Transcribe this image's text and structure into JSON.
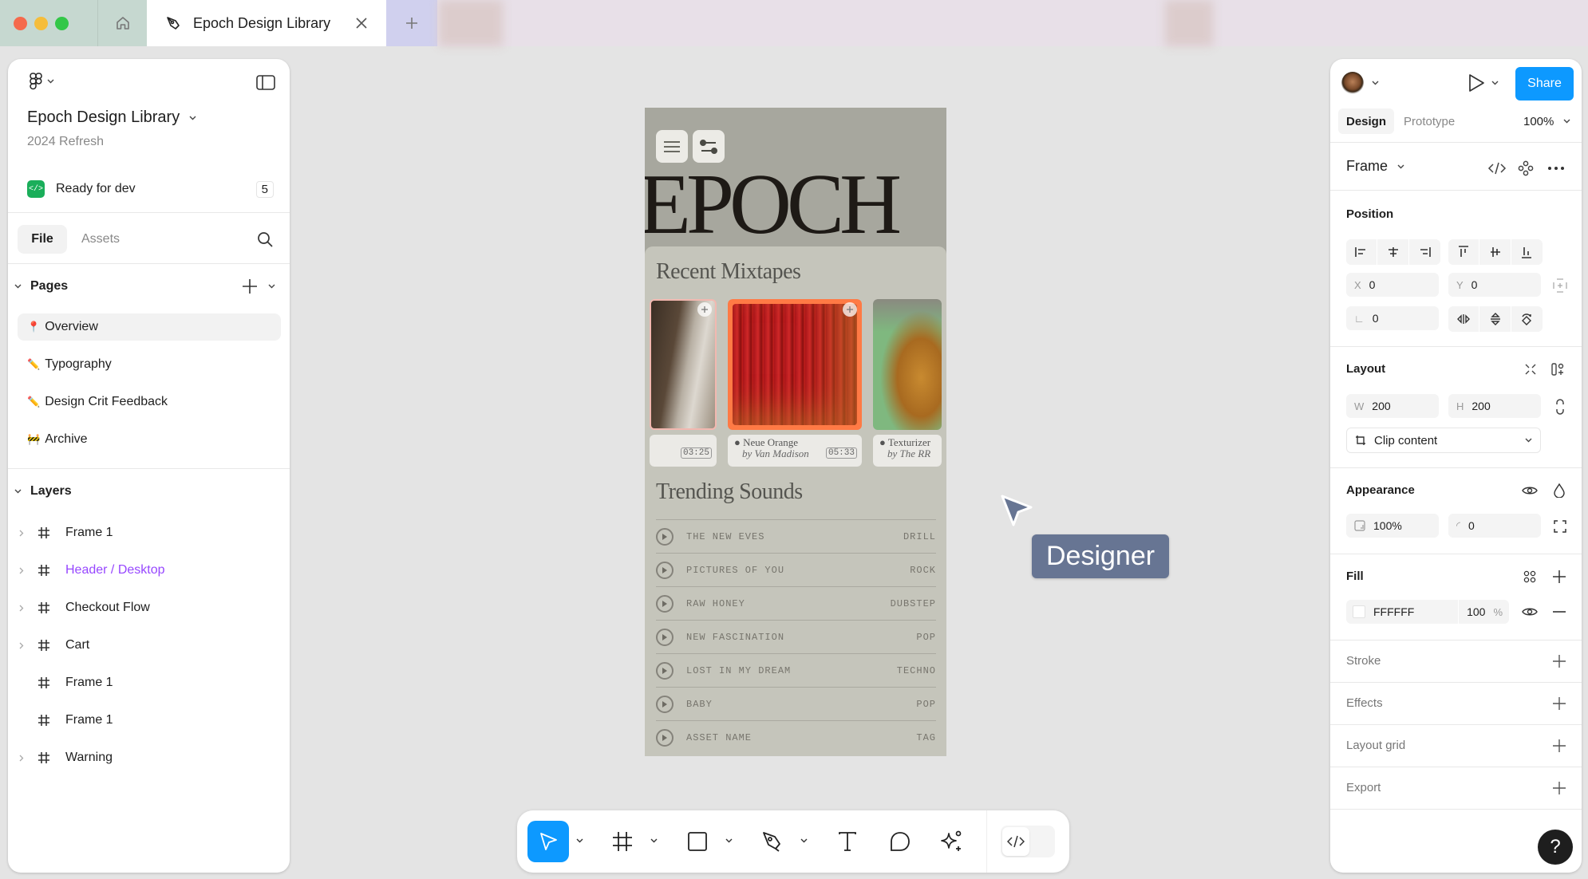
{
  "window": {
    "tab_title": "Epoch Design Library",
    "traffic_colors": [
      "#f56a4c",
      "#f5bd3a",
      "#33c748"
    ]
  },
  "left_panel": {
    "project_title": "Epoch Design Library",
    "project_subtitle": "2024 Refresh",
    "status_label": "Ready for dev",
    "status_count": "5",
    "tabs": [
      {
        "label": "File",
        "active": true
      },
      {
        "label": "Assets",
        "active": false
      }
    ],
    "pages_header": "Pages",
    "pages": [
      {
        "emoji": "📍",
        "label": "Overview",
        "selected": true
      },
      {
        "emoji": "✏️",
        "label": "Typography",
        "selected": false
      },
      {
        "emoji": "✏️",
        "label": "Design Crit Feedback",
        "selected": false
      },
      {
        "emoji": "🚧",
        "label": "Archive",
        "selected": false
      }
    ],
    "layers_header": "Layers",
    "layers": [
      {
        "label": "Frame 1",
        "expandable": true,
        "highlight": false
      },
      {
        "label": "Header / Desktop",
        "expandable": true,
        "highlight": true
      },
      {
        "label": "Checkout Flow",
        "expandable": true,
        "highlight": false
      },
      {
        "label": "Cart",
        "expandable": true,
        "highlight": false
      },
      {
        "label": "Frame 1",
        "expandable": false,
        "highlight": false
      },
      {
        "label": "Frame 1",
        "expandable": false,
        "highlight": false
      },
      {
        "label": "Warning",
        "expandable": true,
        "highlight": false
      }
    ],
    "highlight_color": "#9747ff"
  },
  "canvas": {
    "frame": {
      "brand": "EPOCH",
      "recent_heading": "Recent Mixtapes",
      "mixtapes": [
        {
          "title": "",
          "artist": "",
          "duration": "03:25",
          "accent": "#f2b8b0"
        },
        {
          "title": "Neue Orange",
          "artist": "by Van Madison",
          "duration": "05:33",
          "accent": "#ff7a45"
        },
        {
          "title": "Texturizer",
          "artist": "by The RR",
          "duration": "",
          "accent": "#7fb87f"
        }
      ],
      "trending_heading": "Trending Sounds",
      "tracks": [
        {
          "name": "THE NEW EVES",
          "tag": "DRILL"
        },
        {
          "name": "PICTURES OF YOU",
          "tag": "ROCK"
        },
        {
          "name": "RAW HONEY",
          "tag": "DUBSTEP"
        },
        {
          "name": "NEW FASCINATION",
          "tag": "POP"
        },
        {
          "name": "LOST IN MY DREAM",
          "tag": "TECHNO"
        },
        {
          "name": "BABY",
          "tag": "POP"
        },
        {
          "name": "ASSET NAME",
          "tag": "TAG"
        }
      ]
    },
    "cursor_label": "Designer",
    "cursor_color": "#677593"
  },
  "toolbar": {
    "tools": [
      "move",
      "frame",
      "rectangle",
      "pen",
      "text",
      "comment",
      "actions"
    ],
    "active_tool": "move",
    "accent": "#0d99ff",
    "dev_mode_icon": "code-icon"
  },
  "right_panel": {
    "share_label": "Share",
    "tabs": [
      {
        "label": "Design",
        "active": true
      },
      {
        "label": "Prototype",
        "active": false
      }
    ],
    "zoom": "100%",
    "selection_type": "Frame",
    "position": {
      "title": "Position",
      "x_label": "X",
      "x": "0",
      "y_label": "Y",
      "y": "0",
      "rotation": "0"
    },
    "layout": {
      "title": "Layout",
      "w_label": "W",
      "w": "200",
      "h_label": "H",
      "h": "200",
      "clip": "Clip content"
    },
    "appearance": {
      "title": "Appearance",
      "opacity": "100%",
      "radius": "0"
    },
    "fill": {
      "title": "Fill",
      "hex": "FFFFFF",
      "opacity": "100",
      "unit": "%"
    },
    "sections": [
      "Stroke",
      "Effects",
      "Layout grid",
      "Export"
    ],
    "help": "?",
    "accent": "#0d99ff"
  }
}
